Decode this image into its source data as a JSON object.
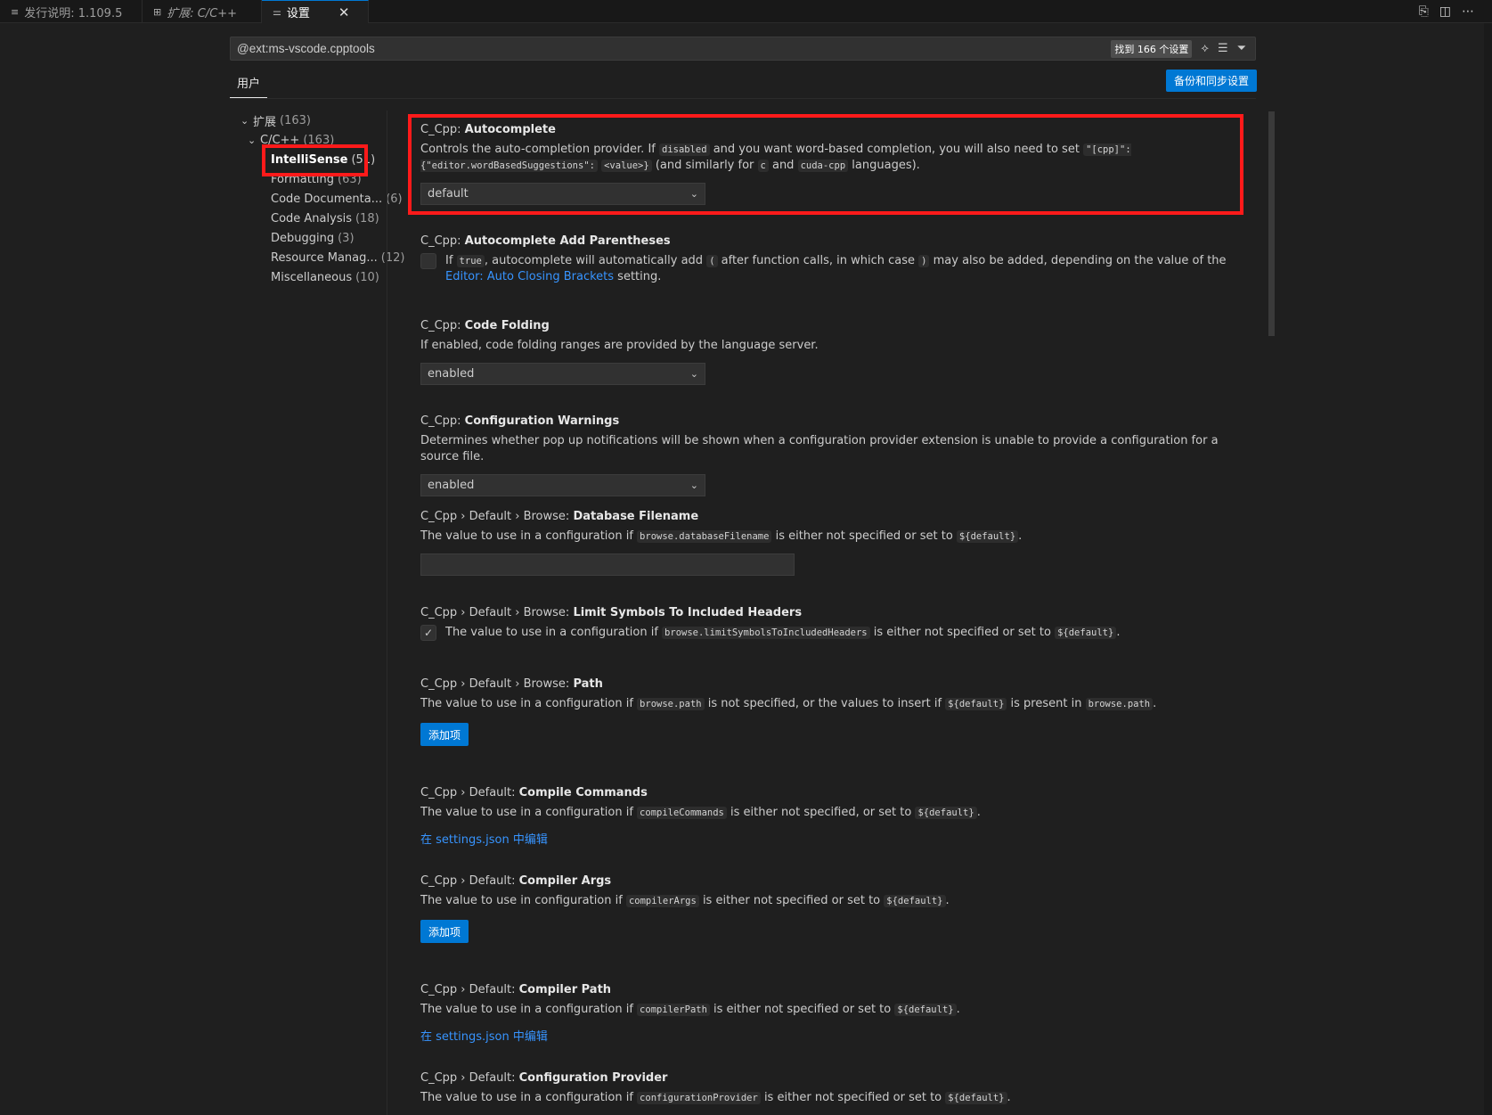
{
  "tabs": [
    {
      "label": "发行说明: 1.109.5",
      "icon": "document-icon"
    },
    {
      "label": "扩展: C/C++",
      "icon": "extensions-icon"
    },
    {
      "label": "设置",
      "icon": "settings-sliders-icon",
      "close": "✕"
    }
  ],
  "editor_actions": [
    "open-settings-json-icon",
    "split-editor-icon",
    "more-actions-icon"
  ],
  "search": {
    "value": "@ext:ms-vscode.cpptools",
    "result_count": "找到 166 个设置",
    "icons": [
      "clear-filter-icon",
      "clear-search-icon",
      "filter-icon"
    ]
  },
  "scope_tab": "用户",
  "sync_button": "备份和同步设置",
  "toc": [
    {
      "label": "扩展",
      "count": "(163)",
      "level": 0,
      "expanded": true
    },
    {
      "label": "C/C++",
      "count": "(163)",
      "level": 1,
      "expanded": true
    },
    {
      "label": "IntelliSense",
      "count": "(51)",
      "level": 2,
      "selected": true
    },
    {
      "label": "Formatting",
      "count": "(63)",
      "level": 2
    },
    {
      "label": "Code Documenta...",
      "count": "(6)",
      "level": 2
    },
    {
      "label": "Code Analysis",
      "count": "(18)",
      "level": 2
    },
    {
      "label": "Debugging",
      "count": "(3)",
      "level": 2
    },
    {
      "label": "Resource Manag...",
      "count": "(12)",
      "level": 2
    },
    {
      "label": "Miscellaneous",
      "count": "(10)",
      "level": 2
    }
  ],
  "settings": {
    "autocomplete": {
      "prefix": "C_Cpp: ",
      "name": "Autocomplete",
      "d1": "Controls the auto-completion provider. If ",
      "c1": "disabled",
      "d2": " and you want word-based completion, you will also need to set ",
      "c2": "\"[cpp]\": {\"editor.wordBasedSuggestions\":",
      "c3": "<value>}",
      "d3": " (and similarly for ",
      "c4": "c",
      "d4": " and ",
      "c5": "cuda-cpp",
      "d5": " languages).",
      "value": "default"
    },
    "autocomplete_parens": {
      "prefix": "C_Cpp: ",
      "name": "Autocomplete Add Parentheses",
      "d1": "If ",
      "c1": "true",
      "d2": ", autocomplete will automatically add ",
      "c2": "(",
      "d3": " after function calls, in which case ",
      "c3": ")",
      "d4": " may also be added, depending on the value of the ",
      "link": "Editor: Auto Closing Brackets",
      "d5": " setting.",
      "checked": false
    },
    "code_folding": {
      "prefix": "C_Cpp: ",
      "name": "Code Folding",
      "desc": "If enabled, code folding ranges are provided by the language server.",
      "value": "enabled"
    },
    "config_warnings": {
      "prefix": "C_Cpp: ",
      "name": "Configuration Warnings",
      "desc": "Determines whether pop up notifications will be shown when a configuration provider extension is unable to provide a configuration for a source file.",
      "value": "enabled"
    },
    "db_filename": {
      "prefix": "C_Cpp › Default › Browse: ",
      "name": "Database Filename",
      "d1": "The value to use in a configuration if ",
      "c1": "browse.databaseFilename",
      "d2": " is either not specified or set to ",
      "c2": "${default}",
      "d3": ".",
      "value": ""
    },
    "limit_symbols": {
      "prefix": "C_Cpp › Default › Browse: ",
      "name": "Limit Symbols To Included Headers",
      "d1": "The value to use in a configuration if ",
      "c1": "browse.limitSymbolsToIncludedHeaders",
      "d2": " is either not specified or set to ",
      "c2": "${default}",
      "d3": ".",
      "checked": true
    },
    "browse_path": {
      "prefix": "C_Cpp › Default › Browse: ",
      "name": "Path",
      "d1": "The value to use in a configuration if ",
      "c1": "browse.path",
      "d2": " is not specified, or the values to insert if ",
      "c2": "${default}",
      "d3": " is present in ",
      "c3": "browse.path",
      "d4": ".",
      "button": "添加项"
    },
    "compile_commands": {
      "prefix": "C_Cpp › Default: ",
      "name": "Compile Commands",
      "d1": "The value to use in a configuration if ",
      "c1": "compileCommands",
      "d2": " is either not specified, or set to ",
      "c2": "${default}",
      "d3": ".",
      "link": "在 settings.json 中编辑"
    },
    "compiler_args": {
      "prefix": "C_Cpp › Default: ",
      "name": "Compiler Args",
      "d1": "The value to use in configuration if ",
      "c1": "compilerArgs",
      "d2": " is either not specified or set to ",
      "c2": "${default}",
      "d3": ".",
      "button": "添加项"
    },
    "compiler_path": {
      "prefix": "C_Cpp › Default: ",
      "name": "Compiler Path",
      "d1": "The value to use in a configuration if ",
      "c1": "compilerPath",
      "d2": " is either not specified or set to ",
      "c2": "${default}",
      "d3": ".",
      "link": "在 settings.json 中编辑"
    },
    "config_provider": {
      "prefix": "C_Cpp › Default: ",
      "name": "Configuration Provider",
      "d1": "The value to use in a configuration if ",
      "c1": "configurationProvider",
      "d2": " is either not specified or set to ",
      "c2": "${default}",
      "d3": "."
    }
  },
  "colors": {
    "accent": "#0078d4",
    "highlight_box": "#ff1a1a",
    "link": "#3794ff"
  }
}
